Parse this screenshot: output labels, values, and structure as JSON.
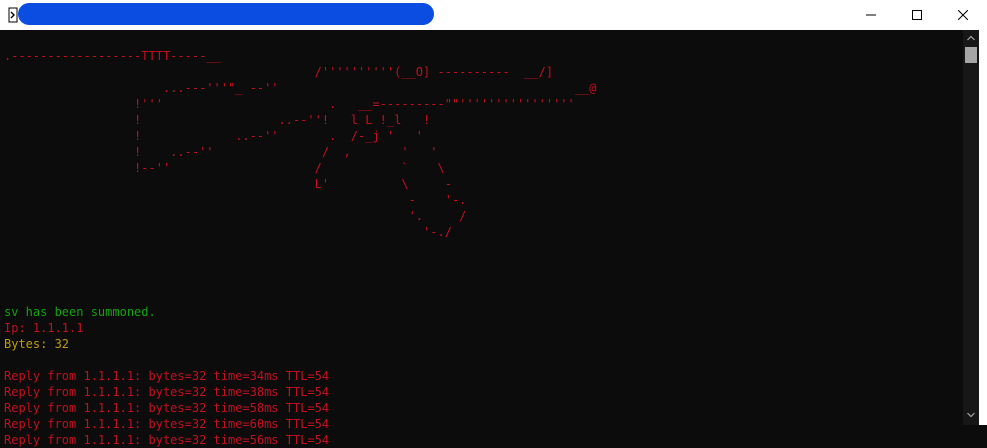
{
  "window": {
    "title": "",
    "title_redacted": true,
    "app_icon": "cmd-icon",
    "controls": {
      "minimize_icon": "minimize-icon",
      "maximize_icon": "maximize-icon",
      "close_icon": "close-icon"
    }
  },
  "terminal": {
    "ascii_art": ".------------------TTTT-----__\n                                           /''''''''''(__O] ----------  __/]\n                      ...---'''\"_ --''                                         __@\n                  !'''                       .   __=---------\"\"''''''''''''''''\n                  !                   ..--''!   l L !_l   !\n                  !             ..--''       .  /-_j '   '\n                  !    ..--''               /  ,       '   '\n                  !--''                    /           `    \\\n                                           L'          \\     -\n                                                        -    '-.\n                                                        '.     /\n                                                          '-./",
    "summoned_line": "sv has been summoned.",
    "ip_line": "Ip: 1.1.1.1",
    "bytes_line": "Bytes: 32",
    "replies": [
      "Reply from 1.1.1.1: bytes=32 time=34ms TTL=54",
      "Reply from 1.1.1.1: bytes=32 time=38ms TTL=54",
      "Reply from 1.1.1.1: bytes=32 time=58ms TTL=54",
      "Reply from 1.1.1.1: bytes=32 time=60ms TTL=54",
      "Reply from 1.1.1.1: bytes=32 time=56ms TTL=54"
    ]
  },
  "colors": {
    "art": "#c50f1f",
    "summoned": "#13a10e",
    "ip": "#c50f1f",
    "bytes": "#c19c00",
    "replies": "#c50f1f",
    "background": "#0c0c0c",
    "title_redaction": "#0a4de0"
  },
  "scrollbar": {
    "up_icon": "scroll-up-arrow-icon",
    "down_icon": "scroll-down-arrow-icon"
  }
}
